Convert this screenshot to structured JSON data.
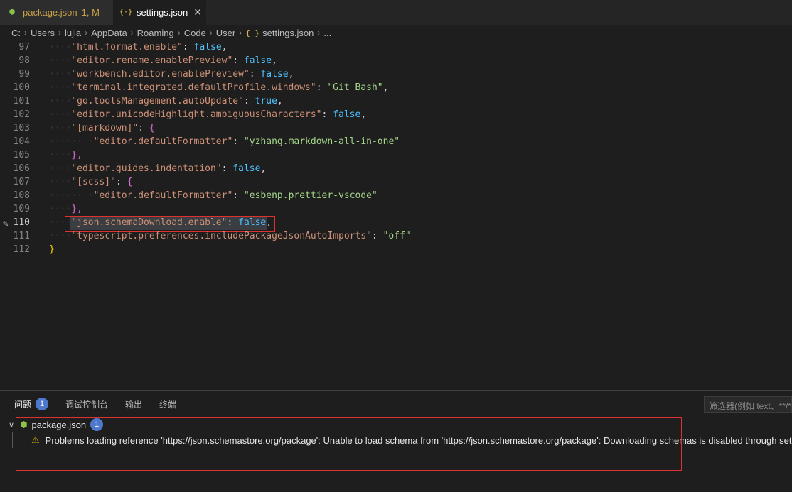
{
  "tabs": [
    {
      "icon": "package-json-icon",
      "label": "package.json",
      "status": "1, M"
    },
    {
      "icon": "json-braces-icon",
      "label": "settings.json",
      "close": "✕"
    }
  ],
  "breadcrumb": [
    "C:",
    "Users",
    "lujia",
    "AppData",
    "Roaming",
    "Code",
    "User",
    "settings.json",
    "..."
  ],
  "breadcrumb_icon": "{ }",
  "editor": {
    "lines": [
      {
        "n": "97",
        "indent": 1,
        "key": "\"html.format.enable\"",
        "val": "false",
        "type": "bool",
        "tail": ","
      },
      {
        "n": "98",
        "indent": 1,
        "key": "\"editor.rename.enablePreview\"",
        "val": "false",
        "type": "bool",
        "tail": ","
      },
      {
        "n": "99",
        "indent": 1,
        "key": "\"workbench.editor.enablePreview\"",
        "val": "false",
        "type": "bool",
        "tail": ","
      },
      {
        "n": "100",
        "indent": 1,
        "key": "\"terminal.integrated.defaultProfile.windows\"",
        "val": "\"Git Bash\"",
        "type": "str",
        "tail": ","
      },
      {
        "n": "101",
        "indent": 1,
        "key": "\"go.toolsManagement.autoUpdate\"",
        "val": "true",
        "type": "bool",
        "tail": ","
      },
      {
        "n": "102",
        "indent": 1,
        "key": "\"editor.unicodeHighlight.ambiguousCharacters\"",
        "val": "false",
        "type": "bool",
        "tail": ","
      },
      {
        "n": "103",
        "indent": 1,
        "key": "\"[markdown]\"",
        "val": "{",
        "type": "brace",
        "tail": ""
      },
      {
        "n": "104",
        "indent": 2,
        "key": "\"editor.defaultFormatter\"",
        "val": "\"yzhang.markdown-all-in-one\"",
        "type": "str",
        "tail": ""
      },
      {
        "n": "105",
        "indent": 1,
        "key": "",
        "val": "},",
        "type": "close",
        "tail": ""
      },
      {
        "n": "106",
        "indent": 1,
        "key": "\"editor.guides.indentation\"",
        "val": "false",
        "type": "bool",
        "tail": ","
      },
      {
        "n": "107",
        "indent": 1,
        "key": "\"[scss]\"",
        "val": "{",
        "type": "brace",
        "tail": ""
      },
      {
        "n": "108",
        "indent": 2,
        "key": "\"editor.defaultFormatter\"",
        "val": "\"esbenp.prettier-vscode\"",
        "type": "str",
        "tail": ""
      },
      {
        "n": "109",
        "indent": 1,
        "key": "",
        "val": "},",
        "type": "close",
        "tail": ""
      },
      {
        "n": "110",
        "indent": 1,
        "key": "\"json.schemaDownload.enable\"",
        "val": "false",
        "type": "bool",
        "tail": ",",
        "current": true
      },
      {
        "n": "111",
        "indent": 1,
        "key": "\"typescript.preferences.includePackageJsonAutoImports\"",
        "val": "\"off\"",
        "type": "str",
        "tail": ""
      },
      {
        "n": "112",
        "indent": 0,
        "key": "",
        "val": "}",
        "type": "root",
        "tail": ""
      }
    ]
  },
  "panel": {
    "tabs": [
      {
        "label": "问题",
        "badge": "1",
        "active": true
      },
      {
        "label": "调试控制台"
      },
      {
        "label": "输出"
      },
      {
        "label": "终端"
      }
    ],
    "filter_placeholder": "筛选器(例如 text、**/*",
    "problem_file": {
      "name": "package.json",
      "count": "1"
    },
    "problem_message": "Problems loading reference 'https://json.schemastore.org/package': Unable to load schema from 'https://json.schemastore.org/package': Downloading schemas is disabled through settings"
  },
  "colors": {
    "accent": "#4d78cc",
    "highlight_box": "#e03131",
    "warning": "#cca700"
  }
}
